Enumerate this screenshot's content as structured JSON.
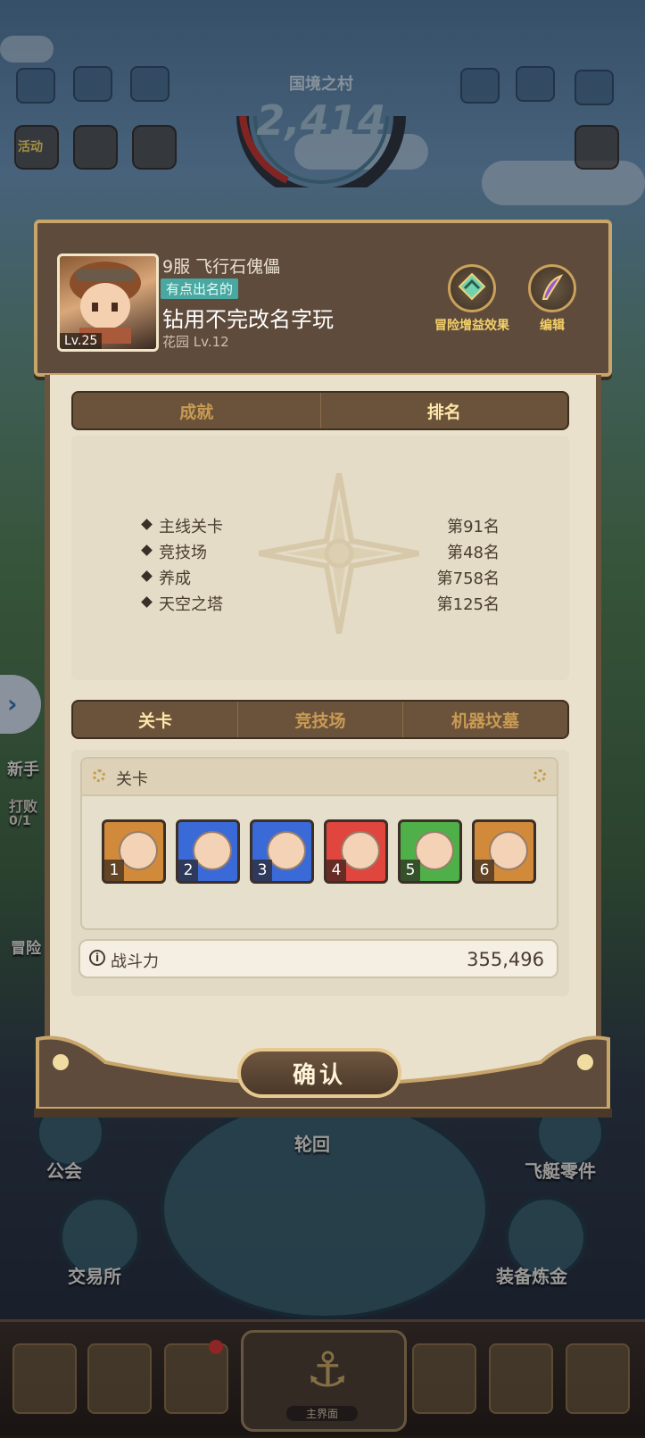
{
  "hud": {
    "title": "国境之村",
    "value": "2,414",
    "activity_label": "活动"
  },
  "background_labels": {
    "guild": "公会",
    "cycle": "轮回",
    "airship_parts": "飞艇零件",
    "exchange": "交易所",
    "equip_refine": "装备炼金",
    "newbie": "新手",
    "defeat": "打败",
    "defeat_count": "0/1",
    "adventure": "冒险",
    "main_screen": "主界面"
  },
  "profile": {
    "server_and_title": "9服 飞行石傀儡",
    "badge": "有点出名的",
    "player_name": "钻用不完改名字玩",
    "garden_level": "花园 Lv.12",
    "avatar_level": "Lv.25",
    "buff_button_label": "冒险增益效果",
    "edit_button_label": "编辑"
  },
  "top_tabs": [
    {
      "label": "成就",
      "active": false
    },
    {
      "label": "排名",
      "active": true
    }
  ],
  "rankings": [
    {
      "name": "主线关卡",
      "rank": "第91名"
    },
    {
      "name": "竞技场",
      "rank": "第48名"
    },
    {
      "name": "养成",
      "rank": "第758名"
    },
    {
      "name": "天空之塔",
      "rank": "第125名"
    }
  ],
  "mode_tabs": [
    {
      "label": "关卡",
      "active": true
    },
    {
      "label": "竞技场",
      "active": false
    },
    {
      "label": "机器坟墓",
      "active": false
    }
  ],
  "stage_section": {
    "title": "关卡",
    "heroes": [
      {
        "slot": "1",
        "color": "#d08a3a"
      },
      {
        "slot": "2",
        "color": "#3a6ad8"
      },
      {
        "slot": "3",
        "color": "#3a6ad8"
      },
      {
        "slot": "4",
        "color": "#e0453e"
      },
      {
        "slot": "5",
        "color": "#4fb04a"
      },
      {
        "slot": "6",
        "color": "#d08a3a"
      }
    ],
    "power_label": "战斗力",
    "power_value": "355,496"
  },
  "confirm_label": "确认"
}
